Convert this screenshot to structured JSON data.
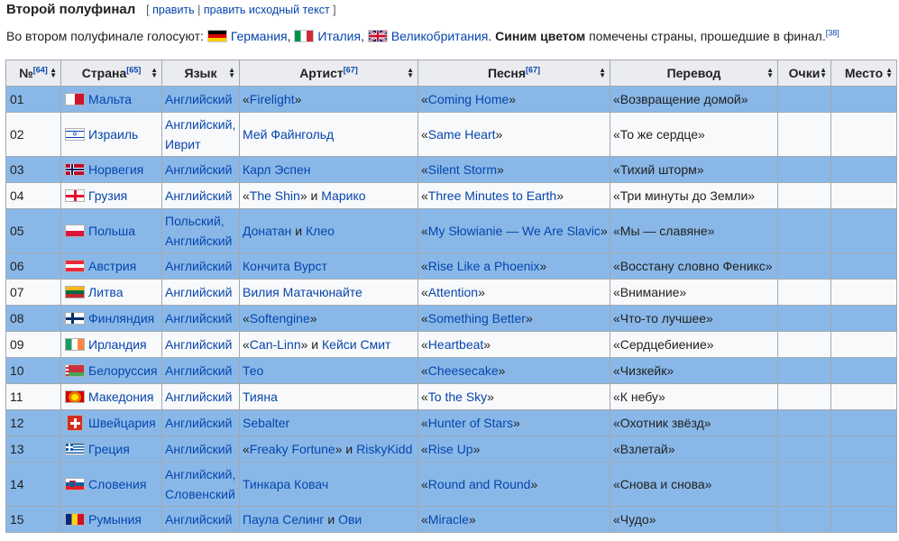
{
  "header": {
    "title": "Второй полуфинал",
    "edit_open": "[",
    "edit": "править",
    "sep": "|",
    "edit_source": "править исходный текст",
    "edit_close": "]"
  },
  "intro": {
    "prefix": "Во втором полуфинале голосуют:",
    "voters": [
      "Германия",
      "Италия",
      "Великобритания"
    ],
    "bold": "Синим цветом",
    "suffix": "помечены страны, прошедшие в финал.",
    "ref": "[38]"
  },
  "columns": [
    {
      "label": "№",
      "ref": "[64]"
    },
    {
      "label": "Страна",
      "ref": "[65]"
    },
    {
      "label": "Язык",
      "ref": ""
    },
    {
      "label": "Артист",
      "ref": "[67]"
    },
    {
      "label": "Песня",
      "ref": "[67]"
    },
    {
      "label": "Перевод",
      "ref": ""
    },
    {
      "label": "Очки",
      "ref": ""
    },
    {
      "label": "Место",
      "ref": ""
    }
  ],
  "rows": [
    {
      "num": "01",
      "country": "Мальта",
      "flag": "malta",
      "lang": [
        "Английский"
      ],
      "artist": [
        {
          "t": "«"
        },
        {
          "l": "Firelight"
        },
        {
          "t": "»"
        }
      ],
      "song": "Coming Home",
      "trans": "«Возвращение домой»",
      "q": true
    },
    {
      "num": "02",
      "country": "Израиль",
      "flag": "israel",
      "lang": [
        "Английский,",
        "Иврит"
      ],
      "artist": [
        {
          "l": "Мей Файнгольд"
        }
      ],
      "song": "Same Heart",
      "trans": "«То же сердце»",
      "q": false
    },
    {
      "num": "03",
      "country": "Норвегия",
      "flag": "norway",
      "lang": [
        "Английский"
      ],
      "artist": [
        {
          "l": "Карл Эспен"
        }
      ],
      "song": "Silent Storm",
      "trans": "«Тихий шторм»",
      "q": true
    },
    {
      "num": "04",
      "country": "Грузия",
      "flag": "georgia",
      "lang": [
        "Английский"
      ],
      "artist": [
        {
          "t": "«"
        },
        {
          "l": "The Shin"
        },
        {
          "t": "» и "
        },
        {
          "l": "Марико"
        }
      ],
      "song": "Three Minutes to Earth",
      "trans": "«Три минуты до Земли»",
      "q": false
    },
    {
      "num": "05",
      "country": "Польша",
      "flag": "poland",
      "lang": [
        "Польский,",
        "Английский"
      ],
      "artist": [
        {
          "l": "Донатан"
        },
        {
          "t": " и "
        },
        {
          "l": "Клео"
        }
      ],
      "song": "My Słowianie — We Are Slavic",
      "trans": "«Мы — славяне»",
      "q": true
    },
    {
      "num": "06",
      "country": "Австрия",
      "flag": "austria",
      "lang": [
        "Английский"
      ],
      "artist": [
        {
          "l": "Кончита Вурст"
        }
      ],
      "song": "Rise Like a Phoenix",
      "trans": "«Восстану словно Феникс»",
      "q": true
    },
    {
      "num": "07",
      "country": "Литва",
      "flag": "lithuania",
      "lang": [
        "Английский"
      ],
      "artist": [
        {
          "l": "Вилия Матачюнайте"
        }
      ],
      "song": "Attention",
      "trans": "«Внимание»",
      "q": false
    },
    {
      "num": "08",
      "country": "Финляндия",
      "flag": "finland",
      "lang": [
        "Английский"
      ],
      "artist": [
        {
          "t": "«"
        },
        {
          "l": "Softengine"
        },
        {
          "t": "»"
        }
      ],
      "song": "Something Better",
      "trans": "«Что-то лучшее»",
      "q": true
    },
    {
      "num": "09",
      "country": "Ирландия",
      "flag": "ireland",
      "lang": [
        "Английский"
      ],
      "artist": [
        {
          "t": "«"
        },
        {
          "l": "Can-Linn"
        },
        {
          "t": "» и "
        },
        {
          "l": "Кейси Смит"
        }
      ],
      "song": "Heartbeat",
      "trans": "«Сердцебиение»",
      "q": false
    },
    {
      "num": "10",
      "country": "Белоруссия",
      "flag": "belarus",
      "lang": [
        "Английский"
      ],
      "artist": [
        {
          "l": "Тео"
        }
      ],
      "song": "Cheesecake",
      "trans": "«Чизкейк»",
      "q": true
    },
    {
      "num": "11",
      "country": "Македония",
      "flag": "macedonia",
      "lang": [
        "Английский"
      ],
      "artist": [
        {
          "l": "Тияна"
        }
      ],
      "song": "To the Sky",
      "trans": "«К небу»",
      "q": false
    },
    {
      "num": "12",
      "country": "Швейцария",
      "flag": "switzerland",
      "lang": [
        "Английский"
      ],
      "artist": [
        {
          "l": "Sebalter"
        }
      ],
      "song": "Hunter of Stars",
      "trans": "«Охотник звёзд»",
      "q": true
    },
    {
      "num": "13",
      "country": "Греция",
      "flag": "greece",
      "lang": [
        "Английский"
      ],
      "artist": [
        {
          "t": "«"
        },
        {
          "l": "Freaky Fortune"
        },
        {
          "t": "» и "
        },
        {
          "l": "RiskyKidd"
        }
      ],
      "song": "Rise Up",
      "trans": "«Взлетай»",
      "q": true
    },
    {
      "num": "14",
      "country": "Словения",
      "flag": "slovenia",
      "lang": [
        "Английский,",
        "Словенский"
      ],
      "artist": [
        {
          "l": "Тинкара Ковач"
        }
      ],
      "song": "Round and Round",
      "trans": "«Снова и снова»",
      "q": true
    },
    {
      "num": "15",
      "country": "Румыния",
      "flag": "romania",
      "lang": [
        "Английский"
      ],
      "artist": [
        {
          "l": "Паула Селинг"
        },
        {
          "t": " и "
        },
        {
          "l": "Ови"
        }
      ],
      "song": "Miracle",
      "trans": "«Чудо»",
      "q": true
    }
  ]
}
